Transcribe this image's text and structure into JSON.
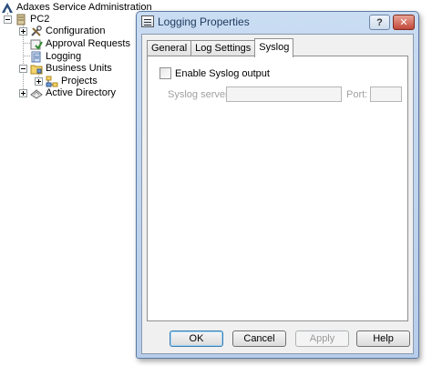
{
  "tree": {
    "root": "Adaxes Service Administration",
    "server": "PC2",
    "items": {
      "configuration": "Configuration",
      "approval_requests": "Approval Requests",
      "logging": "Logging",
      "business_units": "Business Units",
      "projects": "Projects",
      "active_directory": "Active Directory"
    }
  },
  "dialog": {
    "title": "Logging Properties",
    "help_glyph": "?",
    "close_glyph": "✕",
    "tabs": [
      "General",
      "Log Settings",
      "Syslog"
    ],
    "active_tab": "Syslog",
    "enable_syslog": {
      "label": "Enable Syslog output",
      "checked": false
    },
    "syslog_server": {
      "label": "Syslog server:",
      "value": ""
    },
    "port": {
      "label": "Port:",
      "value": ""
    },
    "buttons": {
      "ok": "OK",
      "cancel": "Cancel",
      "apply": "Apply",
      "help": "Help"
    }
  },
  "colors": {
    "dialog_frame": "#b7cde9",
    "close_button": "#c2483a",
    "disabled_text": "#a0a0a0"
  }
}
